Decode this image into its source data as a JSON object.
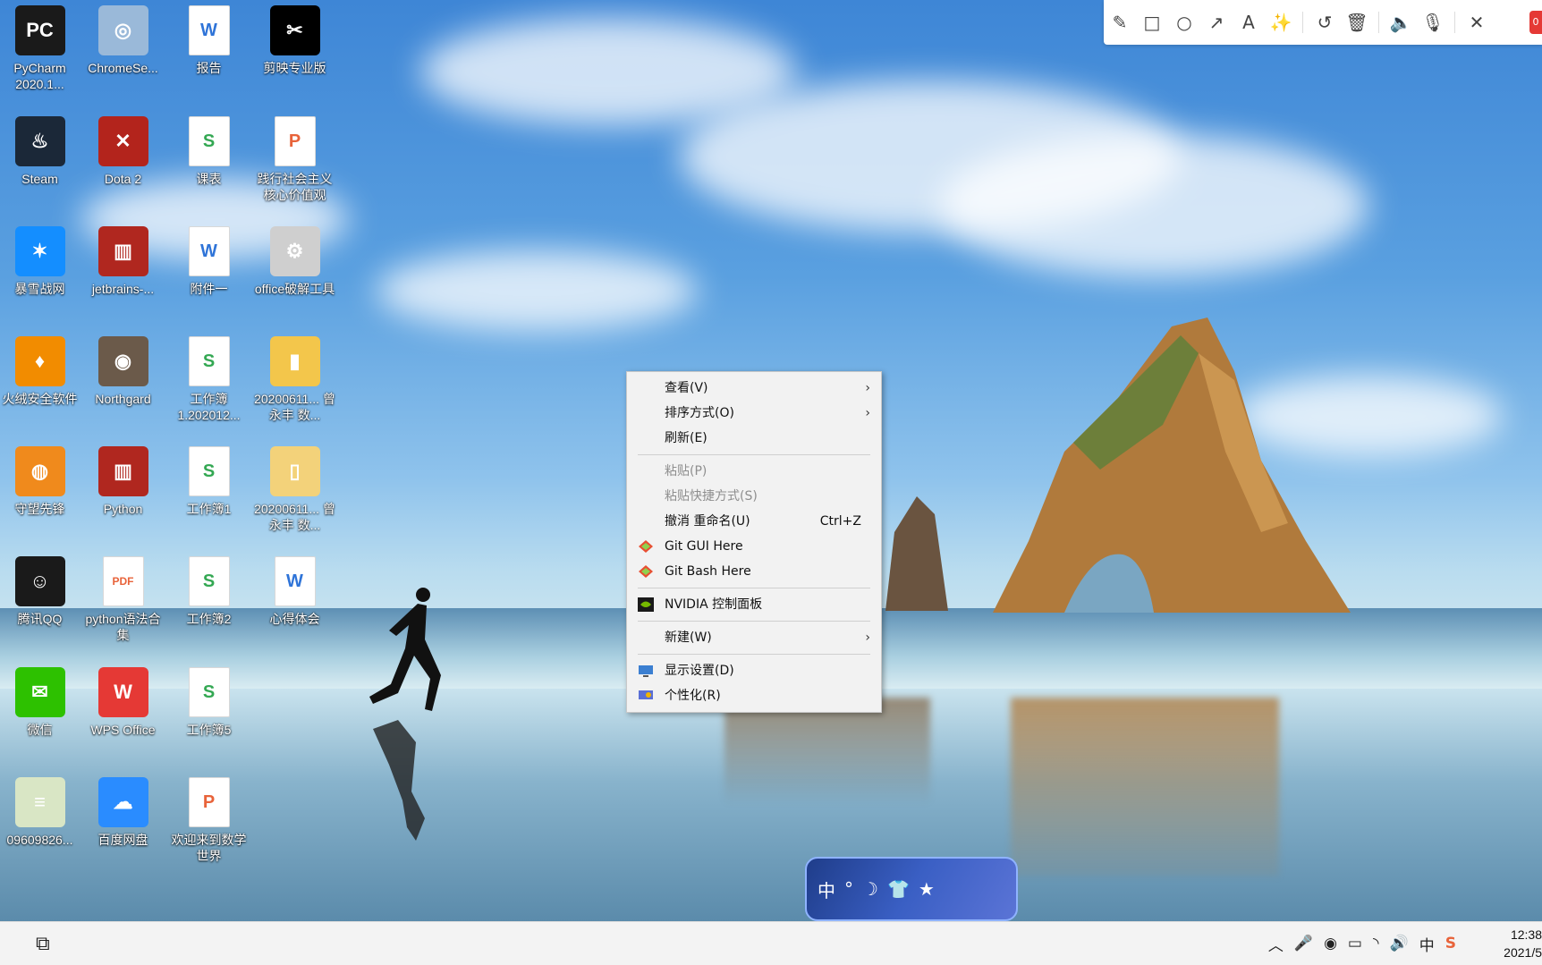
{
  "desktop_icons": [
    {
      "label": "PyCharm 2020.1...",
      "color": "#1a1a1a",
      "glyph": "PC",
      "col": 0,
      "row": 0
    },
    {
      "label": "ChromeSe...",
      "color": "#9ab9d9",
      "glyph": "◎",
      "col": 1,
      "row": 0
    },
    {
      "label": "报告",
      "color": "#2f74d8",
      "glyph": "W",
      "col": 2,
      "row": 0,
      "doc": true
    },
    {
      "label": "剪映专业版",
      "color": "#000000",
      "glyph": "✂",
      "col": 3,
      "row": 0
    },
    {
      "label": "Steam",
      "color": "#1b2838",
      "glyph": "♨",
      "col": 0,
      "row": 1
    },
    {
      "label": "Dota 2",
      "color": "#b3241c",
      "glyph": "✕",
      "col": 1,
      "row": 1
    },
    {
      "label": "课表",
      "color": "#34a853",
      "glyph": "S",
      "col": 2,
      "row": 1,
      "doc": true
    },
    {
      "label": "践行社会主义核心价值观",
      "color": "#e8633a",
      "glyph": "P",
      "col": 3,
      "row": 1,
      "doc": true
    },
    {
      "label": "暴雪战网",
      "color": "#148eff",
      "glyph": "✶",
      "col": 0,
      "row": 2
    },
    {
      "label": "jetbrains-...",
      "color": "#b0271f",
      "glyph": "▥",
      "col": 1,
      "row": 2
    },
    {
      "label": "附件一",
      "color": "#2f74d8",
      "glyph": "W",
      "col": 2,
      "row": 2,
      "doc": true
    },
    {
      "label": "office破解工具",
      "color": "#cfcfcf",
      "glyph": "⚙",
      "col": 3,
      "row": 2
    },
    {
      "label": "火绒安全软件",
      "color": "#f28c00",
      "glyph": "♦",
      "col": 0,
      "row": 3
    },
    {
      "label": "Northgard",
      "color": "#6b5a4a",
      "glyph": "◉",
      "col": 1,
      "row": 3
    },
    {
      "label": "工作簿1.202012...",
      "color": "#34a853",
      "glyph": "S",
      "col": 2,
      "row": 3,
      "doc": true
    },
    {
      "label": "20200611... 曾永丰 数...",
      "color": "#f3c64b",
      "glyph": "▮",
      "col": 3,
      "row": 3
    },
    {
      "label": "守望先锋",
      "color": "#f08a1c",
      "glyph": "◍",
      "col": 0,
      "row": 4
    },
    {
      "label": "Python",
      "color": "#b0271f",
      "glyph": "▥",
      "col": 1,
      "row": 4
    },
    {
      "label": "工作簿1",
      "color": "#34a853",
      "glyph": "S",
      "col": 2,
      "row": 4,
      "doc": true
    },
    {
      "label": "20200611... 曾永丰 数...",
      "color": "#f3d27a",
      "glyph": "▯",
      "col": 3,
      "row": 4
    },
    {
      "label": "腾讯QQ",
      "color": "#1a1a1a",
      "glyph": "☺",
      "col": 0,
      "row": 5
    },
    {
      "label": "python语法合集",
      "color": "#e8633a",
      "glyph": "PDF",
      "col": 1,
      "row": 5,
      "doc": true
    },
    {
      "label": "工作簿2",
      "color": "#34a853",
      "glyph": "S",
      "col": 2,
      "row": 5,
      "doc": true
    },
    {
      "label": "心得体会",
      "color": "#2f74d8",
      "glyph": "W",
      "col": 3,
      "row": 5,
      "doc": true
    },
    {
      "label": "微信",
      "color": "#2dc100",
      "glyph": "✉",
      "col": 0,
      "row": 6
    },
    {
      "label": "WPS Office",
      "color": "#e53935",
      "glyph": "W",
      "col": 1,
      "row": 6
    },
    {
      "label": "工作簿5",
      "color": "#34a853",
      "glyph": "S",
      "col": 2,
      "row": 6,
      "doc": true
    },
    {
      "label": "09609826...",
      "color": "#d9e6c5",
      "glyph": "≡",
      "col": 0,
      "row": 7
    },
    {
      "label": "百度网盘",
      "color": "#2a8cff",
      "glyph": "☁",
      "col": 1,
      "row": 7
    },
    {
      "label": "欢迎来到数学世界",
      "color": "#e8633a",
      "glyph": "P",
      "col": 2,
      "row": 7,
      "doc": true
    }
  ],
  "toolbar": {
    "tools": [
      {
        "name": "pencil-icon",
        "glyph": "✎"
      },
      {
        "name": "rectangle-icon",
        "glyph": "□"
      },
      {
        "name": "circle-icon",
        "glyph": "○"
      },
      {
        "name": "arrow-icon",
        "glyph": "↗"
      },
      {
        "name": "text-icon",
        "glyph": "A"
      },
      {
        "name": "magic-wand-icon",
        "glyph": "✨"
      },
      {
        "name": "undo-icon",
        "glyph": "↺"
      },
      {
        "name": "trash-icon",
        "glyph": "🗑"
      },
      {
        "name": "speaker-icon",
        "glyph": "🔈"
      },
      {
        "name": "microphone-icon",
        "glyph": "🎙"
      },
      {
        "name": "close-icon",
        "glyph": "✕"
      }
    ],
    "badge": "0"
  },
  "context_menu": {
    "view": "查看(V)",
    "sort": "排序方式(O)",
    "refresh": "刷新(E)",
    "paste": "粘贴(P)",
    "paste_shortcut": "粘贴快捷方式(S)",
    "undo_rename": "撤消 重命名(U)",
    "undo_shortcut": "Ctrl+Z",
    "git_gui": "Git GUI Here",
    "git_bash": "Git Bash Here",
    "nvidia": "NVIDIA 控制面板",
    "new": "新建(W)",
    "display": "显示设置(D)",
    "personalize": "个性化(R)"
  },
  "ime_bar": {
    "lang": "中",
    "icons": [
      "°",
      "☽",
      "👕",
      "★"
    ]
  },
  "taskbar": {
    "task_view_glyph": "⧉",
    "tray_glyphs": [
      "︿",
      "🎤",
      "◉",
      "▭",
      "◝",
      "🔊",
      "中",
      "S"
    ],
    "time": "12:38",
    "date": "2021/5"
  },
  "colors": {
    "menu_bg": "#f2f2f2",
    "taskbar_bg": "#f3f3f3",
    "accent": "#e53935"
  }
}
